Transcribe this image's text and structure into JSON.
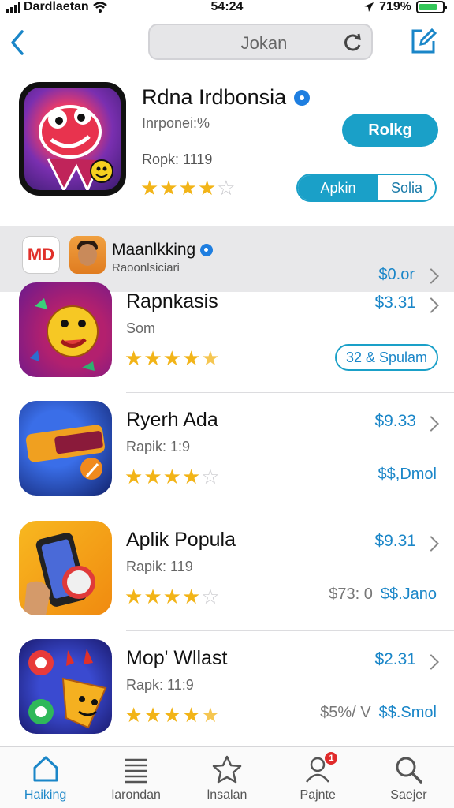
{
  "status": {
    "carrier": "Dardlaetan",
    "time": "54:24",
    "battery": "719%"
  },
  "nav": {
    "search_text": "Jokan"
  },
  "featured": {
    "title": "Rdna Irdbonsia",
    "subtitle": "Inrponei:%",
    "rank": "Ropk: 1119",
    "rating": 4,
    "get_label": "Rolkg",
    "segment_a": "Apkin",
    "segment_b": "Solia"
  },
  "section": {
    "logo_text": "MD",
    "title": "Maanlkking",
    "subtitle": "Raoonlsiciari",
    "price": "$0.or"
  },
  "apps": [
    {
      "title": "Rapnkasis",
      "subtitle": "Som",
      "rating": 4.5,
      "price": "$3.31",
      "pill": "32 & Spulam",
      "muted": "",
      "extra": ""
    },
    {
      "title": "Ryerh Ada",
      "subtitle": "Rapik: 1:9",
      "rating": 4,
      "price": "$9.33",
      "pill": "",
      "muted": "",
      "extra": "$$,Dmol"
    },
    {
      "title": "Aplik Popula",
      "subtitle": "Rapik: 119",
      "rating": 4,
      "price": "$9.31",
      "pill": "",
      "muted": "$73: 0",
      "extra": "$$.Jano"
    },
    {
      "title": "Mop' Wllast",
      "subtitle": "Rapk: 11:9",
      "rating": 4.5,
      "price": "$2.31",
      "pill": "",
      "muted": "$5%/ V",
      "extra": "$$.Smol"
    }
  ],
  "tabs": [
    {
      "label": "Haiking",
      "icon": "home-icon"
    },
    {
      "label": "larondan",
      "icon": "list-icon"
    },
    {
      "label": "lnsalan",
      "icon": "star-icon"
    },
    {
      "label": "Pajnte",
      "icon": "person-icon",
      "badge": "1"
    },
    {
      "label": "Saejer",
      "icon": "search-icon"
    }
  ],
  "colors": {
    "accent": "#1aa0c8",
    "price": "#1a86c8",
    "star": "#f2b418",
    "badge": "#e02a2a"
  }
}
